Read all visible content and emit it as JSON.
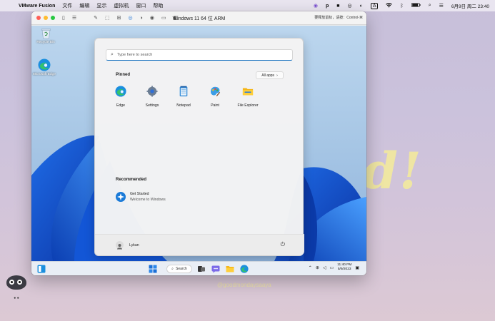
{
  "mac_menubar": {
    "app_name": "VMware Fusion",
    "menus": [
      "文件",
      "编辑",
      "显示",
      "虚拟机",
      "窗口",
      "帮助"
    ],
    "clock": "6月9日 周二 23:40",
    "status_icons": [
      "vpn-icon",
      "p-icon",
      "chat-icon",
      "circle-icon",
      "contrast-icon",
      "input-method-icon",
      "wifi-icon",
      "bluetooth-icon",
      "battery-icon",
      "search-icon",
      "control-center-icon"
    ],
    "input_label": "A"
  },
  "vm_window": {
    "title": "Windows 11 64 位 ARM",
    "hint": "要释放鼠标，请按：Control-⌘"
  },
  "windows": {
    "desktop_icons": [
      {
        "label": "Recycle Bin",
        "icon": "recycle-bin-icon"
      },
      {
        "label": "Microsoft Edge",
        "icon": "edge-icon"
      }
    ],
    "start_menu": {
      "search_placeholder": "Type here to search",
      "pinned_title": "Pinned",
      "all_apps_label": "All apps",
      "pinned": [
        {
          "label": "Edge",
          "icon": "edge-icon"
        },
        {
          "label": "Settings",
          "icon": "settings-gear-icon"
        },
        {
          "label": "Notepad",
          "icon": "notepad-icon"
        },
        {
          "label": "Paint",
          "icon": "paint-icon"
        },
        {
          "label": "File Explorer",
          "icon": "folder-icon"
        }
      ],
      "recommended_title": "Recommended",
      "recommended": [
        {
          "title": "Get Started",
          "subtitle": "Welcome to Windows",
          "icon": "get-started-icon"
        }
      ],
      "user_name": "Lykan"
    },
    "taskbar": {
      "search_label": "Search",
      "time": "11:40 PM",
      "date": "5/9/2023"
    }
  },
  "watermark": "@goodmondaysaaya"
}
